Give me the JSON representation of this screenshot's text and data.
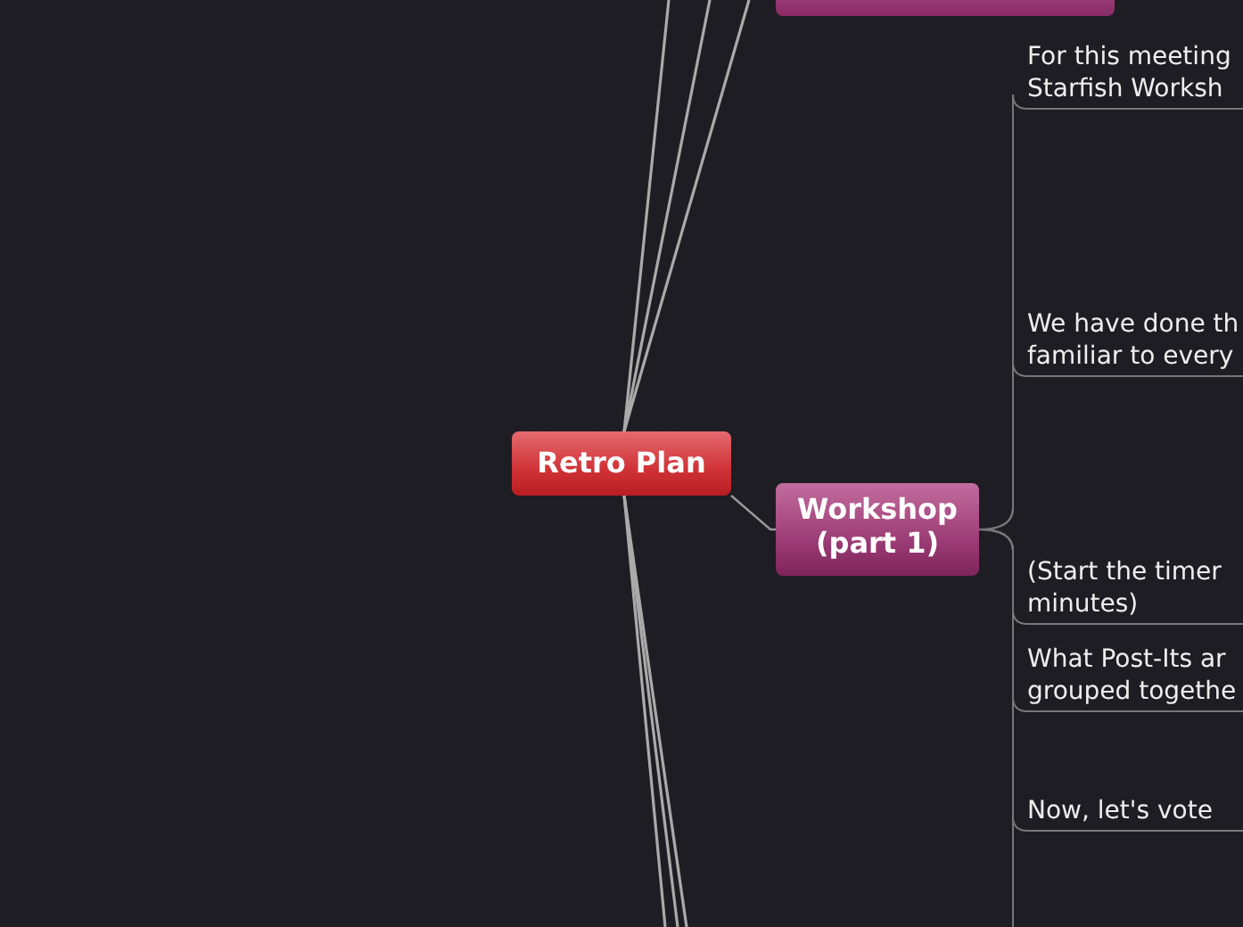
{
  "root": {
    "label": "Retro Plan"
  },
  "topics": [
    {
      "kind": "cut"
    },
    {
      "kind": "branch",
      "label": "Workshop\n(part 1)",
      "notes": [
        {
          "lines": [
            "For this meeting",
            "Starfish Worksh"
          ]
        },
        {
          "lines": [
            "We have done th",
            "familiar to every"
          ]
        },
        {
          "lines": [
            "(Start the timer",
            "minutes)"
          ]
        },
        {
          "lines": [
            "What Post-Its ar",
            "grouped togethe"
          ]
        },
        {
          "lines": [
            "Now, let's vote"
          ]
        }
      ]
    }
  ]
}
